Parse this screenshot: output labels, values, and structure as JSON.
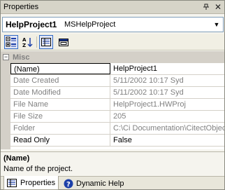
{
  "window": {
    "title": "Properties",
    "pin_icon": "pushpin-icon",
    "close_icon": "close-icon"
  },
  "selector": {
    "object_name": "HelpProject1",
    "object_type": "MSHelpProject"
  },
  "toolbar": {
    "buttons": [
      {
        "name": "categorized-icon",
        "active": true
      },
      {
        "name": "alphabetical-icon",
        "active": false
      },
      {
        "name": "properties-icon",
        "active": true
      },
      {
        "name": "property-pages-icon",
        "active": false
      }
    ]
  },
  "grid": {
    "category": "Misc",
    "category_toggle": "−",
    "rows": [
      {
        "name": "(Name)",
        "value": "HelpProject1",
        "editable": true
      },
      {
        "name": "Date Created",
        "value": "5/11/2002 10:17 Syd",
        "editable": false
      },
      {
        "name": "Date Modified",
        "value": "5/11/2002 10:17 Syd",
        "editable": false
      },
      {
        "name": "File Name",
        "value": "HelpProject1.HWProj",
        "editable": false
      },
      {
        "name": "File Size",
        "value": "205",
        "editable": false
      },
      {
        "name": "Folder",
        "value": "C:\\Ci Documentation\\CitectObject",
        "editable": false
      },
      {
        "name": "Read Only",
        "value": "False",
        "editable": true
      }
    ]
  },
  "description": {
    "title": "(Name)",
    "text": "Name of the project."
  },
  "tabs": [
    {
      "label": "Properties",
      "active": true
    },
    {
      "label": "Dynamic Help",
      "active": false
    }
  ],
  "colors": {
    "accent": "#316ac5",
    "readonly_text": "#808080",
    "help_icon_bg": "#1c3fa8"
  }
}
